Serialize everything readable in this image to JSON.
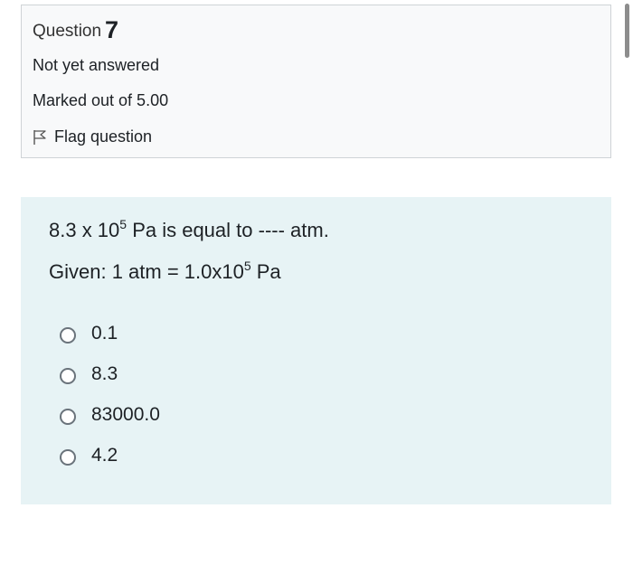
{
  "question_info": {
    "question_label": "Question",
    "question_number": "7",
    "state": "Not yet answered",
    "grade": "Marked out of 5.00",
    "flag_label": "Flag question"
  },
  "question": {
    "line1_prefix": "8.3 x 10",
    "line1_exponent": "5",
    "line1_suffix": " Pa is equal to ---- atm.",
    "line2_prefix": "Given: 1 atm = 1.0x10",
    "line2_exponent": "5",
    "line2_suffix": " Pa"
  },
  "answers": [
    {
      "label": "0.1"
    },
    {
      "label": "8.3"
    },
    {
      "label": "83000.0"
    },
    {
      "label": "4.2"
    }
  ]
}
